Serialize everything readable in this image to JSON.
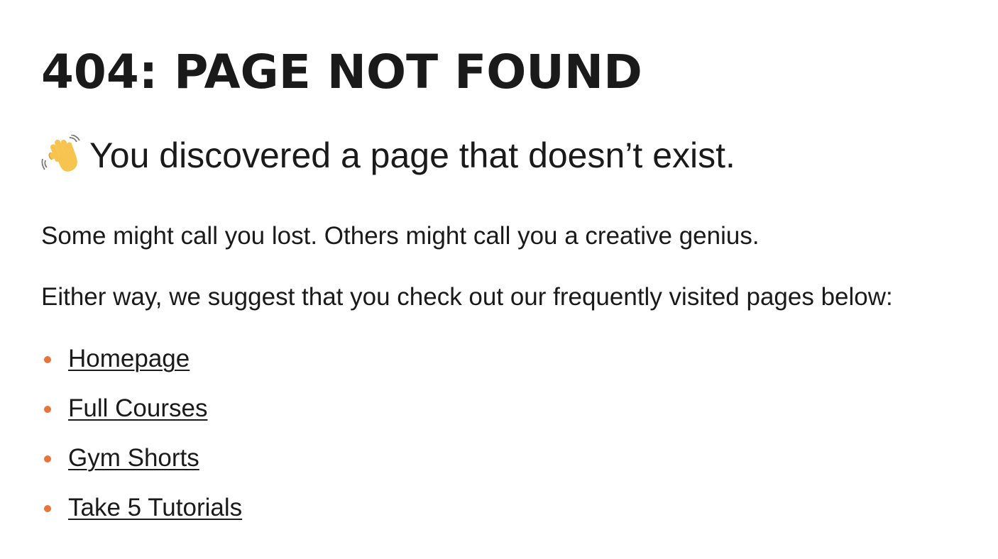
{
  "page": {
    "title": "404: PAGE NOT FOUND",
    "subtitle": "You discovered a page that doesn’t exist.",
    "subtitle_icon": "waving-hand-icon",
    "paragraph_1": "Some might call you lost. Others might call you a creative genius.",
    "paragraph_2": "Either way, we suggest that you check out our frequently visited pages below:",
    "bullet_color": "#e8743b",
    "links": [
      {
        "label": "Homepage"
      },
      {
        "label": "Full Courses"
      },
      {
        "label": "Gym Shorts"
      },
      {
        "label": "Take 5 Tutorials"
      }
    ]
  }
}
